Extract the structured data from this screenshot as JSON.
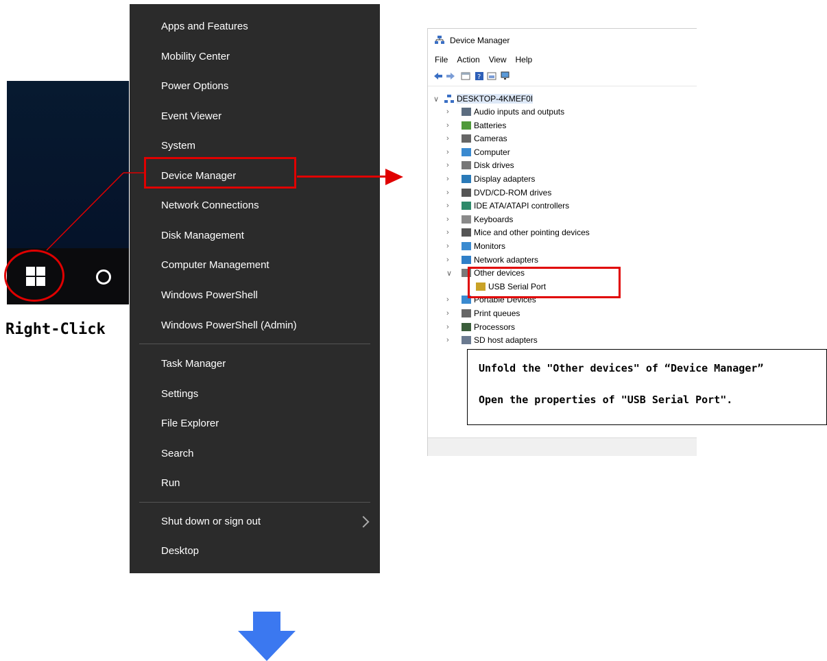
{
  "taskbar": {
    "instruction": "Right-Click"
  },
  "winx_menu": {
    "items": [
      "Apps and Features",
      "Mobility Center",
      "Power Options",
      "Event Viewer",
      "System",
      "Device Manager",
      "Network Connections",
      "Disk Management",
      "Computer Management",
      "Windows PowerShell",
      "Windows PowerShell (Admin)",
      "Task Manager",
      "Settings",
      "File Explorer",
      "Search",
      "Run",
      "Shut down or sign out",
      "Desktop"
    ],
    "highlighted": "Device Manager"
  },
  "device_manager": {
    "title": "Device Manager",
    "menu": [
      "File",
      "Action",
      "View",
      "Help"
    ],
    "computer": "DESKTOP-4KMEF0I",
    "categories": [
      "Audio inputs and outputs",
      "Batteries",
      "Cameras",
      "Computer",
      "Disk drives",
      "Display adapters",
      "DVD/CD-ROM drives",
      "IDE ATA/ATAPI controllers",
      "Keyboards",
      "Mice and other pointing devices",
      "Monitors",
      "Network adapters",
      "Other devices",
      "Portable Devices",
      "Print queues",
      "Processors",
      "SD host adapters"
    ],
    "expanded_category": "Other devices",
    "child_device": "USB Serial Port"
  },
  "callout": {
    "line1": "Unfold the \"Other devices\" of “Device Manager”",
    "line2": "Open the properties of \"USB Serial Port\"."
  },
  "colors": {
    "highlight_red": "#e00000",
    "menu_bg": "#2b2b2b",
    "arrow_blue": "#3b78f0"
  }
}
